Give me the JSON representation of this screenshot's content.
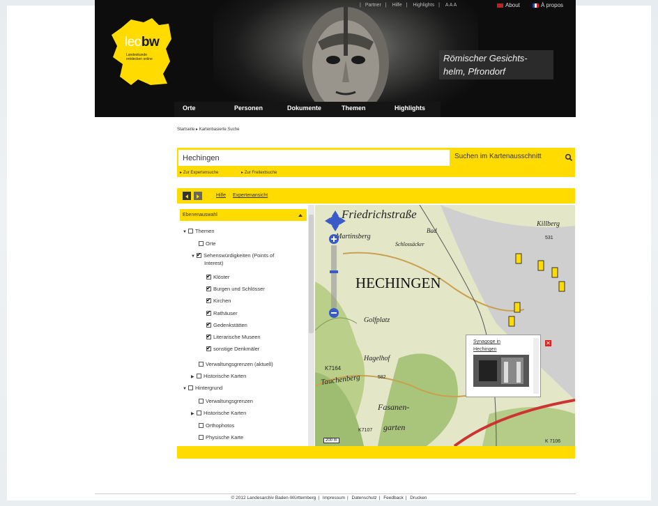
{
  "brand": {
    "logo_light": "leo",
    "logo_bold": "bw",
    "tagline": "Landeskunde entdecken online"
  },
  "topnav": {
    "items": [
      "Partner",
      "Hilfe",
      "Highlights"
    ],
    "font_size": "A A A",
    "about": "About",
    "apropos": "À propos"
  },
  "header": {
    "caption": "Römischer Gesichts- helm, Pfrondorf"
  },
  "mainnav": [
    "Orte",
    "Personen",
    "Dokumente",
    "Themen",
    "Highlights"
  ],
  "breadcrumb": {
    "home": "Startseite",
    "current": "Kartenbasierte Suche"
  },
  "search": {
    "value": "Hechingen",
    "button": "Suchen im Kartenausschnitt",
    "expert": "Zur Expertensuche",
    "fulltext": "Zur Freitextsuche"
  },
  "toolbar": {
    "help": "Hilfe",
    "expert_view": "Expertenansicht"
  },
  "panel": {
    "title": "Ebenenauswahl",
    "items": [
      {
        "label": "Themen",
        "checked": false
      },
      {
        "label": "Orte",
        "checked": false
      },
      {
        "label": "Sehenswürdigkeiten (Points of",
        "label2": "Interest)",
        "checked": true
      },
      {
        "label": "Klöster",
        "checked": true
      },
      {
        "label": "Burgen und Schlösser",
        "checked": true
      },
      {
        "label": "Kirchen",
        "checked": true
      },
      {
        "label": "Rathäuser",
        "checked": true
      },
      {
        "label": "Gedenkstätten",
        "checked": true
      },
      {
        "label": "Literarische Museen",
        "checked": true
      },
      {
        "label": "sonstige Denkmäler",
        "checked": true
      },
      {
        "label": "Verwaltungsgrenzen (aktuell)",
        "checked": false
      },
      {
        "label": "Historische Karten",
        "checked": false
      },
      {
        "label": "Hintergrund",
        "checked": false
      },
      {
        "label": "Verwaltungsgrenzen",
        "checked": false
      },
      {
        "label": "Historische Karten",
        "checked": false
      },
      {
        "label": "Orthophotos",
        "checked": false
      },
      {
        "label": "Physische Karte",
        "checked": false
      }
    ]
  },
  "map": {
    "labels": {
      "friedrichstrasse": "Friedrichstraße",
      "killberg": "Killberg",
      "hechingen": "HECHINGEN",
      "golfplatz": "Golfplatz",
      "hagelhof": "Hagelhof",
      "tauchenberg": "Tauchenberg",
      "fasanengarten": "Fasanen-",
      "garten": "garten",
      "martinsberg": "Martinsberg",
      "bad": "Bad",
      "schlossacker": "Schlossäcker",
      "k7164": "K7164",
      "k7106": "K 7106",
      "k7107": "K7107",
      "elev531": "531",
      "elev582": "582",
      "scale": "200 m"
    },
    "popup": {
      "title": "Synagoge in Hechingen"
    }
  },
  "footer": {
    "copyright": "© 2012 Landesarchiv Baden-Württemberg",
    "links": [
      "Impressum",
      "Datenschutz",
      "Feedback",
      "Drucken"
    ]
  }
}
